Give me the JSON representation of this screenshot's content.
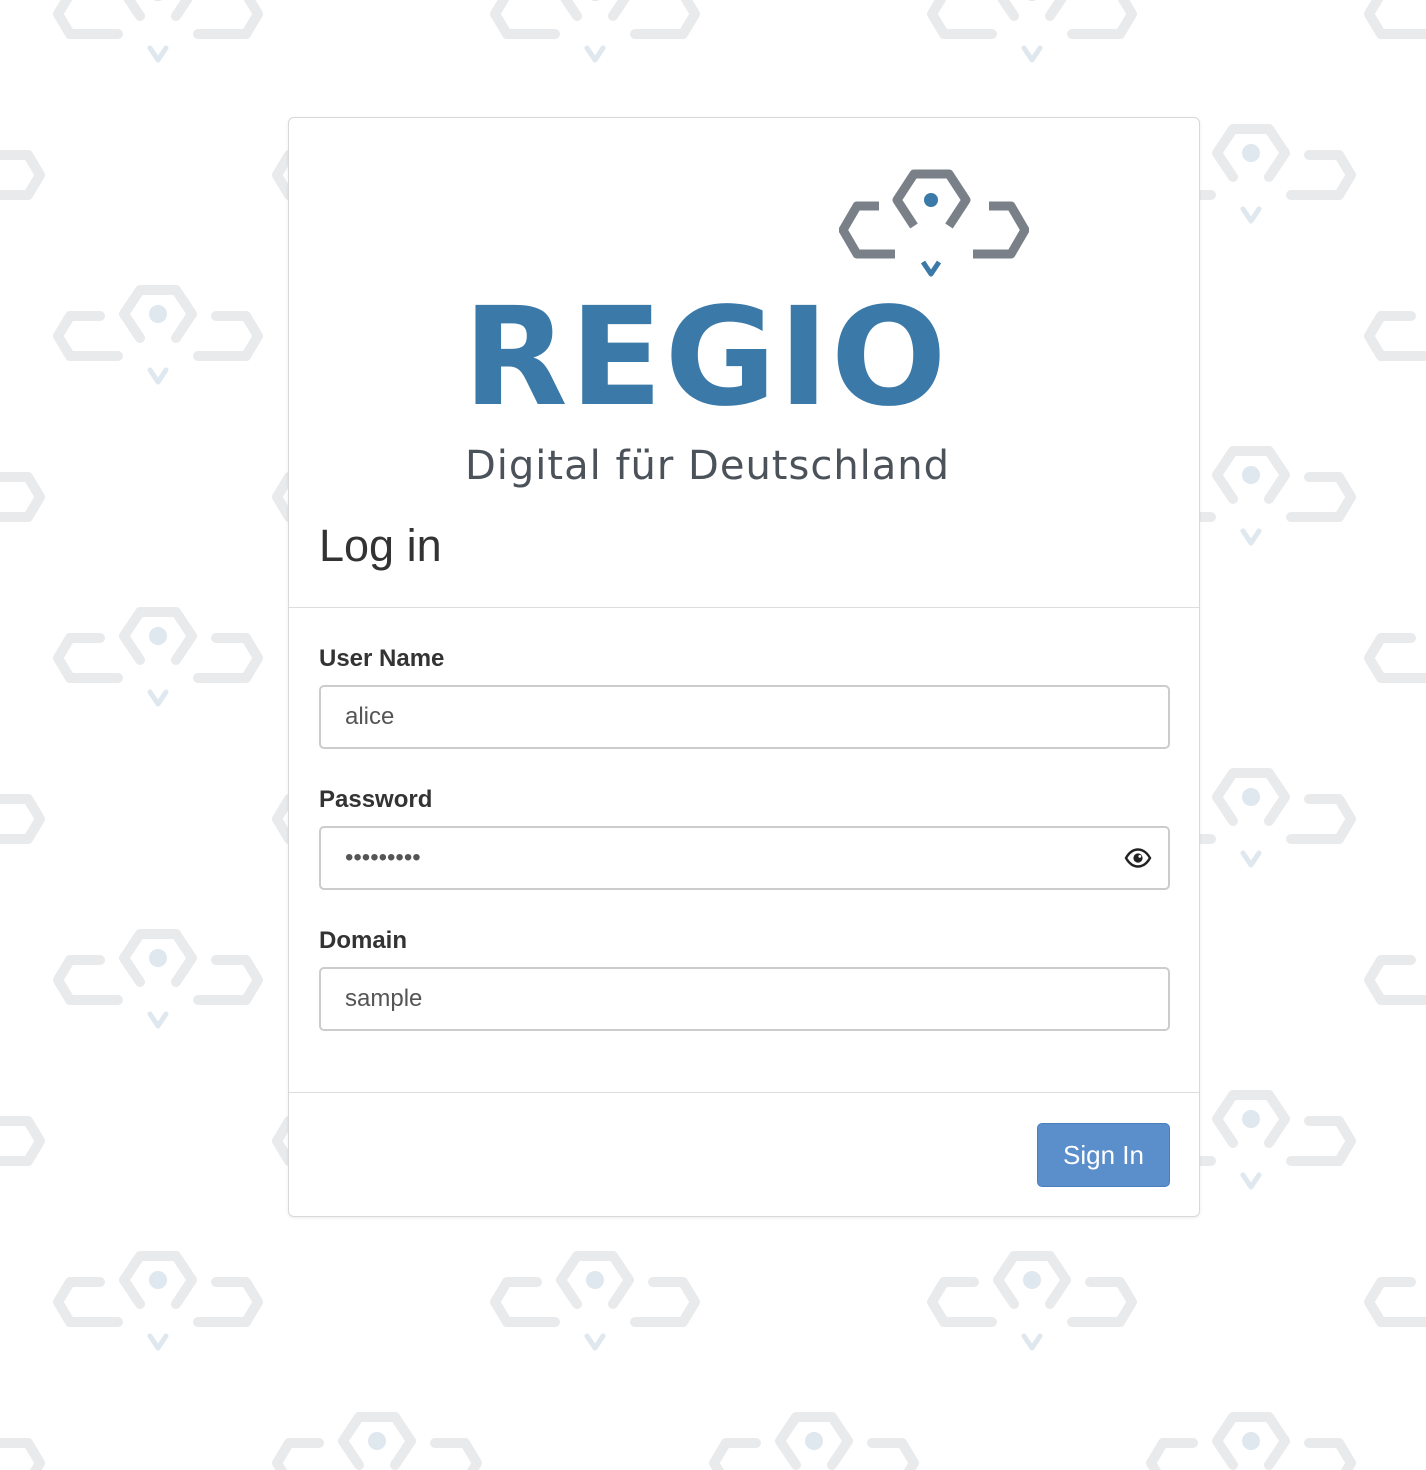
{
  "brand": {
    "name": "REGIO",
    "tagline": "Digital für Deutschland",
    "primary_color": "#3b79a8",
    "mark_color": "#7a8088"
  },
  "page": {
    "title": "Log in"
  },
  "form": {
    "username": {
      "label": "User Name",
      "value": "alice"
    },
    "password": {
      "label": "Password",
      "value": "passwords",
      "toggle_icon": "eye-icon"
    },
    "domain": {
      "label": "Domain",
      "value": "sample"
    }
  },
  "actions": {
    "sign_in_label": "Sign In",
    "button_color": "#5a8fcc"
  }
}
